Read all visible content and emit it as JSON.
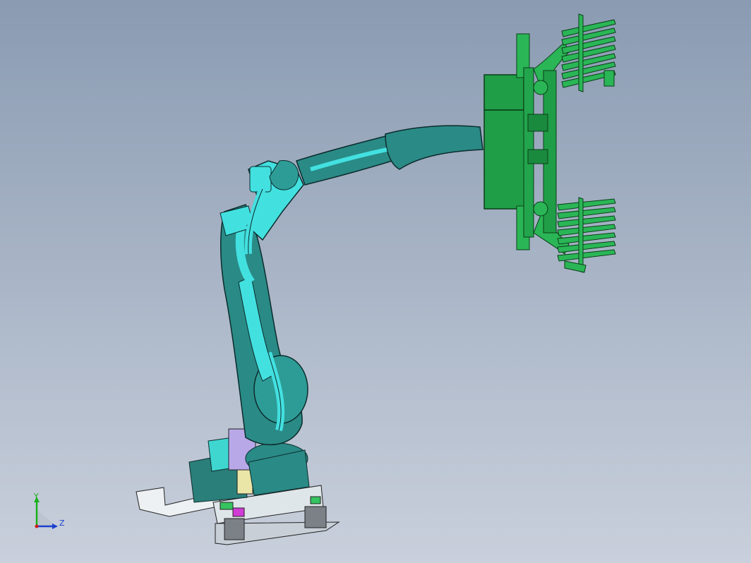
{
  "viewport": {
    "background_top": "#8a9bb2",
    "background_bottom": "#c9d0dc"
  },
  "model": {
    "colors": {
      "robot_body": "#2a8a86",
      "robot_highlight": "#43e0e0",
      "robot_outline": "#0b2c2c",
      "gripper": "#1f9e47",
      "gripper_outline": "#0b3d18",
      "base_plate": "#e8ecef",
      "motor": "#b8a8e8",
      "accent_magenta": "#d13cd6"
    }
  },
  "triad": {
    "y_label": "Y",
    "z_label": "Z",
    "y_color": "#1bb01b",
    "z_color": "#1b3fd0",
    "x_color": "#d01b1b"
  }
}
